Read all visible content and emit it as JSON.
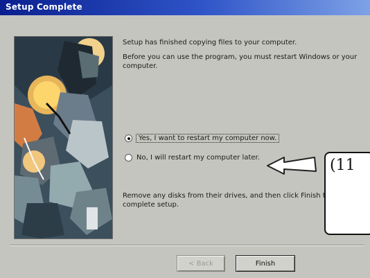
{
  "window": {
    "title": "Setup Complete"
  },
  "messages": {
    "line1": "Setup has finished copying files to your computer.",
    "line2": "Before you can use the program, you must restart Windows or your computer.",
    "remove_disks": "Remove any disks from their drives, and then click Finish to complete setup."
  },
  "options": [
    {
      "label": "Yes, I want to restart my computer now.",
      "selected": true
    },
    {
      "label": "No, I will restart my computer later.",
      "selected": false
    }
  ],
  "buttons": {
    "back": "< Back",
    "finish": "Finish"
  },
  "callout": {
    "text": "(11"
  }
}
